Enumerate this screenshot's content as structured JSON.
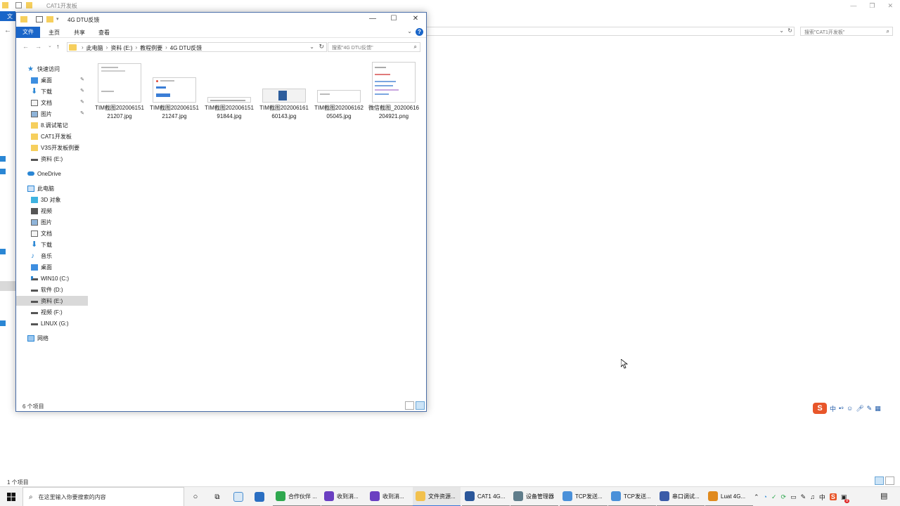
{
  "background_window": {
    "title": "CAT1开发板",
    "file_tab": "文",
    "search_placeholder": "搜索\"CAT1开发板\"",
    "status_text": "1 个项目"
  },
  "window": {
    "title": "4G DTU反馈",
    "ribbon_tabs": [
      "文件",
      "主页",
      "共享",
      "查看"
    ],
    "breadcrumb": [
      "此电脑",
      "资料 (E:)",
      "教程例要",
      "4G DTU反馈"
    ],
    "search_placeholder": "搜索\"4G DTU反馈\"",
    "status_text": "6 个项目"
  },
  "sidebar": {
    "items": [
      {
        "label": "快速访问",
        "icon": "star-icon",
        "pinned": false
      },
      {
        "label": "桌面",
        "icon": "desktop-icon",
        "pinned": true
      },
      {
        "label": "下载",
        "icon": "download-icon",
        "pinned": true
      },
      {
        "label": "文档",
        "icon": "document-icon",
        "pinned": true
      },
      {
        "label": "图片",
        "icon": "picture-icon",
        "pinned": true
      },
      {
        "label": "8.调试笔记",
        "icon": "folder-icon",
        "pinned": false
      },
      {
        "label": "CAT1开发板",
        "icon": "folder-icon",
        "pinned": false
      },
      {
        "label": "V3S开发板例要",
        "icon": "folder-icon",
        "pinned": false
      },
      {
        "label": "资料 (E:)",
        "icon": "drive-icon",
        "pinned": false
      },
      {
        "label": "OneDrive",
        "icon": "cloud-icon",
        "pinned": false
      },
      {
        "label": "此电脑",
        "icon": "computer-icon",
        "pinned": false
      },
      {
        "label": "3D 对象",
        "icon": "3d-objects-icon",
        "pinned": false
      },
      {
        "label": "视频",
        "icon": "video-icon",
        "pinned": false
      },
      {
        "label": "图片",
        "icon": "picture-icon",
        "pinned": false
      },
      {
        "label": "文档",
        "icon": "document-icon",
        "pinned": false
      },
      {
        "label": "下载",
        "icon": "download-icon",
        "pinned": false
      },
      {
        "label": "音乐",
        "icon": "music-icon",
        "pinned": false
      },
      {
        "label": "桌面",
        "icon": "desktop-icon",
        "pinned": false
      },
      {
        "label": "WIN10 (C:)",
        "icon": "system-drive-icon",
        "pinned": false
      },
      {
        "label": "软件 (D:)",
        "icon": "drive-icon",
        "pinned": false
      },
      {
        "label": "资料 (E:)",
        "icon": "drive-icon",
        "pinned": false,
        "selected": true
      },
      {
        "label": "视频 (F:)",
        "icon": "drive-icon",
        "pinned": false
      },
      {
        "label": "LINUX (G:)",
        "icon": "drive-icon",
        "pinned": false
      },
      {
        "label": "网络",
        "icon": "network-icon",
        "pinned": false
      }
    ]
  },
  "files": [
    {
      "name": "TIM截图20200615121207.jpg"
    },
    {
      "name": "TIM截图20200615121247.jpg"
    },
    {
      "name": "TIM截图20200615191844.jpg"
    },
    {
      "name": "TIM截图20200616160143.jpg"
    },
    {
      "name": "TIM截图20200616205045.jpg"
    },
    {
      "name": "微信截图_20200616204921.png"
    }
  ],
  "ime": {
    "logo": "S",
    "mode": "中"
  },
  "taskbar": {
    "search_placeholder": "在这里输入你要搜索的内容",
    "apps": [
      {
        "label": "合作伙伴 ...",
        "color": "#2fa84f"
      },
      {
        "label": "收到消...",
        "color": "#6a3fc1"
      },
      {
        "label": "收到消...",
        "color": "#6a3fc1"
      },
      {
        "label": "文件资源...",
        "color": "#f2c14e"
      },
      {
        "label": "CAT1 4G...",
        "color": "#2b579a"
      },
      {
        "label": "设备管理器",
        "color": "#607d8b"
      },
      {
        "label": "TCP发送...",
        "color": "#4a90d9"
      },
      {
        "label": "TCP发送...",
        "color": "#4a90d9"
      },
      {
        "label": "串口调试...",
        "color": "#3b5ba8"
      },
      {
        "label": "Luat 4G...",
        "color": "#e08a1e"
      }
    ],
    "tray_lang": "中",
    "tray_badge": "8"
  }
}
